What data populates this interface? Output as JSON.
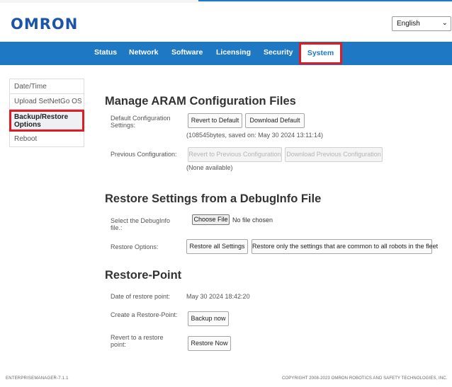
{
  "brand": {
    "logo_text": "OMRON",
    "accent_color": "#1f78c4",
    "highlight_color": "#e01b24"
  },
  "language": {
    "selected": "English",
    "icon": "chevron-down-icon"
  },
  "nav": {
    "items": [
      {
        "label": "Status"
      },
      {
        "label": "Network"
      },
      {
        "label": "Software"
      },
      {
        "label": "Licensing"
      },
      {
        "label": "Security"
      },
      {
        "label": "System",
        "active": true
      }
    ]
  },
  "sidebar": {
    "items": [
      {
        "label": "Date/Time"
      },
      {
        "label": "Upload SetNetGo OS"
      },
      {
        "label": "Backup/Restore Options",
        "active": true
      },
      {
        "label": "Reboot"
      }
    ]
  },
  "aram": {
    "title": "Manage ARAM Configuration Files",
    "default_label": "Default Configuration Settings:",
    "revert_default": "Revert to Default",
    "download_default": "Download Default",
    "default_info": "(108545bytes, saved on: May 30 2024 13:11:14)",
    "previous_label": "Previous Configuration:",
    "revert_previous": "Revert to Previous Configuration",
    "download_previous": "Download Previous Configuration",
    "previous_info": "(None available)"
  },
  "debuginfo": {
    "title": "Restore Settings from a DebugInfo File",
    "select_label": "Select the DebugInfo file.:",
    "choose_file": "Choose File",
    "file_status": "No file chosen",
    "options_label": "Restore Options:",
    "restore_all": "Restore all Settings",
    "restore_common": "Restore only the settings that are common to all robots in the fleet"
  },
  "restore_point": {
    "title": "Restore-Point",
    "date_label": "Date of restore point:",
    "date_value": "May 30 2024 18:42:20",
    "create_label": "Create a Restore-Point:",
    "backup_now": "Backup now",
    "revert_label": "Revert to a restore point:",
    "restore_now": "Restore Now"
  },
  "footer": {
    "version": "ENTERPRISEMANAGER-7.1.1",
    "copyright": "COPYRIGHT 2008-2023 OMRON ROBOTICS AND SAFETY TECHNOLOGIES, INC."
  }
}
